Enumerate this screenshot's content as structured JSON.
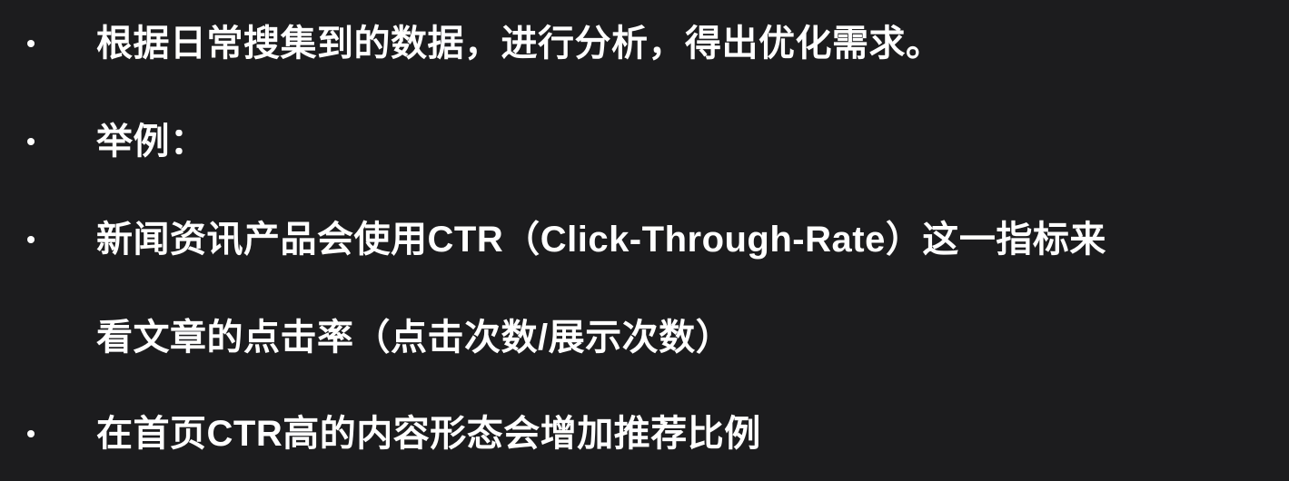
{
  "slide": {
    "bullet_glyph": "•",
    "items": [
      {
        "text": "根据日常搜集到的数据，进行分析，得出优化需求。"
      },
      {
        "text": "举例："
      },
      {
        "text": "新闻资讯产品会使用CTR（Click-Through-Rate）这一指标来"
      },
      {
        "text": "在首页CTR高的内容形态会增加推荐比例"
      }
    ],
    "continuation": {
      "text": "看文章的点击率（点击次数/展示次数）"
    }
  }
}
